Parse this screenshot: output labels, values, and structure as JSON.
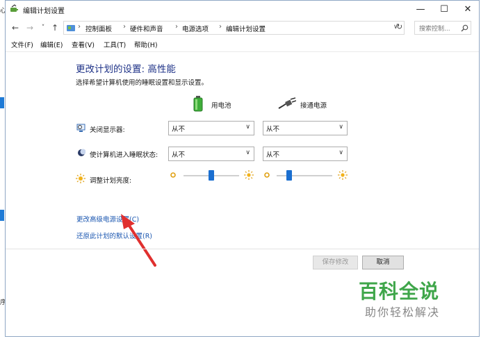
{
  "background_window": {
    "glyphs": [
      "心",
      "序"
    ]
  },
  "window": {
    "title": "编辑计划设置",
    "controls": {
      "minimize": "—",
      "maximize": "☐",
      "close": "✕"
    }
  },
  "address_bar": {
    "back": "←",
    "forward": "→",
    "history": "˅",
    "up": "↑",
    "breadcrumbs": [
      "控制面板",
      "硬件和声音",
      "电源选项",
      "编辑计划设置"
    ],
    "separator": "›",
    "dropdown": "∨",
    "refresh": "↻",
    "search_placeholder": "搜索控制..."
  },
  "menu": [
    "文件(F)",
    "编辑(E)",
    "查看(V)",
    "工具(T)",
    "帮助(H)"
  ],
  "main": {
    "heading": "更改计划的设置: 高性能",
    "subtext": "选择希望计算机使用的睡眠设置和显示设置。",
    "columns": {
      "battery": "用电池",
      "plugged_in": "接通电源"
    },
    "settings": {
      "display_off": {
        "label": "关闭显示器:",
        "battery": "从不",
        "plugged_in": "从不"
      },
      "sleep": {
        "label": "使计算机进入睡眠状态:",
        "battery": "从不",
        "plugged_in": "从不"
      },
      "brightness": {
        "label": "调整计划亮度:",
        "battery_level": 0.5,
        "plugged_in_level": 0.2
      }
    },
    "select_chevron": "∨",
    "links": {
      "advanced": "更改高级电源设置(C)",
      "restore": "还原此计划的默认设置(R)"
    },
    "buttons": {
      "save": "保存修改",
      "cancel": "取消"
    }
  },
  "watermark": {
    "main": "百科全说",
    "sub": "助你轻松解决"
  },
  "colors": {
    "link": "#1a56b0",
    "heading": "#1e3287",
    "slider": "#1b6fd0",
    "arrow": "#e0302f",
    "watermark": "#3fa64a"
  }
}
